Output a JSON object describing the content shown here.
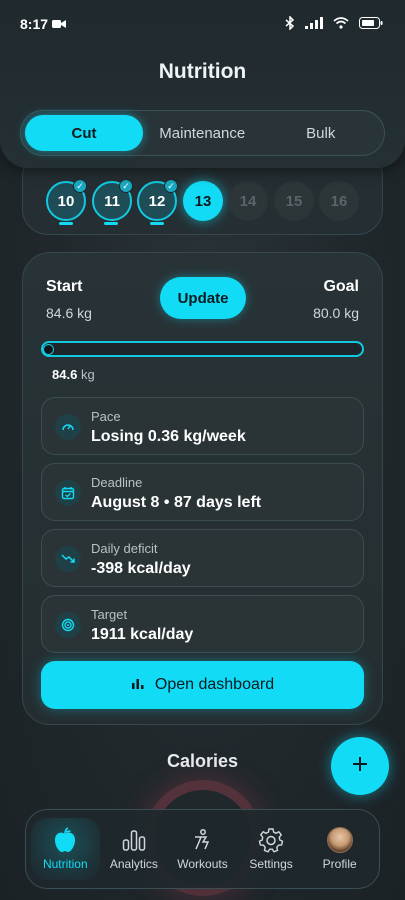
{
  "status_bar": {
    "time": "8:17"
  },
  "header": {
    "title": "Nutrition"
  },
  "mode_toggle": {
    "options": [
      "Cut",
      "Maintenance",
      "Bulk"
    ],
    "selected": "Cut"
  },
  "days": [
    {
      "label": "10",
      "state": "done"
    },
    {
      "label": "11",
      "state": "done"
    },
    {
      "label": "12",
      "state": "done"
    },
    {
      "label": "13",
      "state": "current"
    },
    {
      "label": "14",
      "state": "future"
    },
    {
      "label": "15",
      "state": "future"
    },
    {
      "label": "16",
      "state": "future"
    }
  ],
  "goal": {
    "start_label": "Start",
    "start_value": "84.6 kg",
    "update_label": "Update",
    "goal_label": "Goal",
    "goal_value": "80.0 kg",
    "progress_fraction": 0.0,
    "current_value": "84.6",
    "current_unit": "kg"
  },
  "info": [
    {
      "label": "Pace",
      "value": "Losing 0.36 kg/week",
      "icon": "gauge-icon"
    },
    {
      "label": "Deadline",
      "value": "August 8 • 87 days left",
      "icon": "calendar-icon"
    },
    {
      "label": "Daily deficit",
      "value": "-398 kcal/day",
      "icon": "trend-down-icon"
    },
    {
      "label": "Target",
      "value": "1911 kcal/day",
      "icon": "target-icon"
    }
  ],
  "dashboard_button": "Open dashboard",
  "calories_title": "Calories",
  "nav": [
    {
      "label": "Nutrition",
      "icon": "apple-icon",
      "active": true
    },
    {
      "label": "Analytics",
      "icon": "bar-chart-icon",
      "active": false
    },
    {
      "label": "Workouts",
      "icon": "workout-icon",
      "active": false
    },
    {
      "label": "Settings",
      "icon": "gear-icon",
      "active": false
    },
    {
      "label": "Profile",
      "icon": "avatar",
      "active": false
    }
  ],
  "colors": {
    "accent": "#12dcf5",
    "background": "#20282c",
    "card": "#283337"
  }
}
